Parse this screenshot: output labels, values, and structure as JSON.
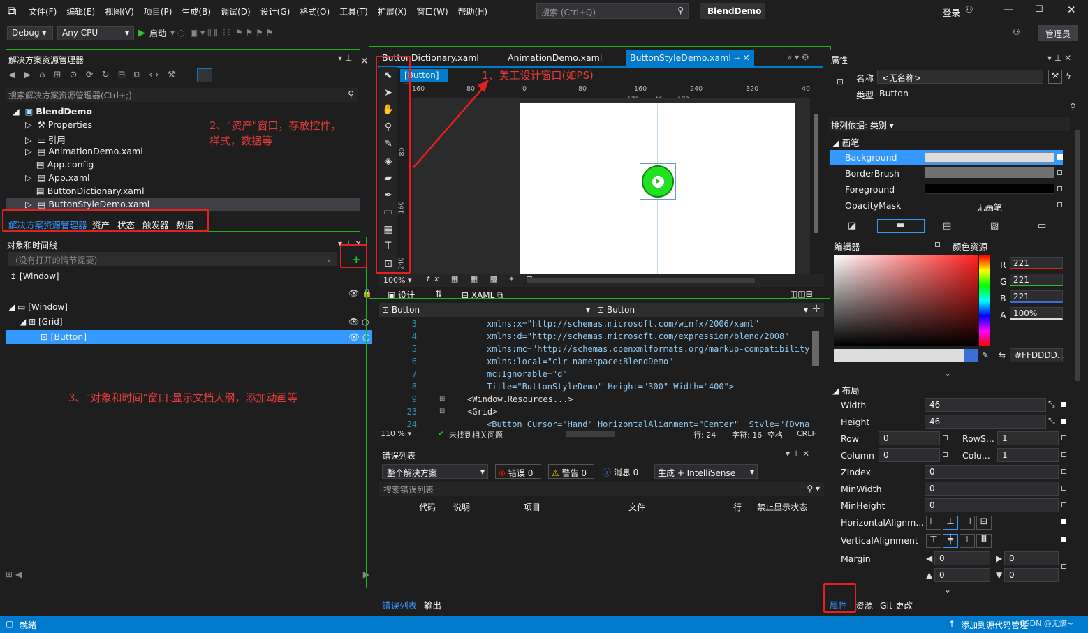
{
  "menu": {
    "items": [
      "文件(F)",
      "编辑(E)",
      "视图(V)",
      "项目(P)",
      "生成(B)",
      "调试(D)",
      "设计(G)",
      "格式(O)",
      "工具(T)",
      "扩展(X)",
      "窗口(W)",
      "帮助(H)"
    ],
    "search_placeholder": "搜索 (Ctrl+Q)",
    "app_name": "BlendDemo",
    "login": "登录",
    "admin": "管理员"
  },
  "toolbar": {
    "config": "Debug",
    "platform": "Any CPU",
    "start": "启动"
  },
  "solution": {
    "title": "解决方案资源管理器",
    "search": "搜索解决方案资源管理器(Ctrl+;)",
    "root": "BlendDemo",
    "items": [
      "Properties",
      "引用",
      "AnimationDemo.xaml",
      "App.config",
      "App.xaml",
      "ButtonDictionary.xaml",
      "ButtonStyleDemo.xaml"
    ],
    "tabs": [
      "解决方案资源管理器",
      "资产",
      "状态",
      "触发器",
      "数据"
    ]
  },
  "objects": {
    "title": "对象和时间线",
    "storyboard": "(没有打开的情节提要)",
    "window_top": "[Window]",
    "window": "[Window]",
    "grid": "[Grid]",
    "button": "[Button]"
  },
  "notes": {
    "n1": "1、美工设计窗口(如PS)",
    "n2a": "2、\"资产\"窗口，存放控件，",
    "n2b": "样式，数据等",
    "n3": "3、\"对象和时间\"窗口:显示文档大纲，添加动画等"
  },
  "editor": {
    "tabs": [
      "ButtonDictionary.xaml",
      "AnimationDemo.xaml",
      "ButtonStyleDemo.xaml"
    ],
    "breadcrumb": "[Button]",
    "ruler_h": [
      "160",
      "80",
      "0",
      "80",
      "160",
      "240",
      "320",
      "40"
    ],
    "ruler_marks": [
      "173",
      "46",
      "173"
    ],
    "ruler_v": [
      "80",
      "160",
      "240"
    ],
    "zoom": "100%",
    "design_tab": "设计",
    "xaml_tab": "XAML",
    "scope_left": "Button",
    "scope_right": "Button",
    "line_numbers": [
      "3",
      "4",
      "5",
      "6",
      "7",
      "8",
      "9",
      "23",
      "24"
    ],
    "code": [
      "xmlns:x=\"http://schemas.microsoft.com/winfx/2006/xaml\"",
      "xmlns:d=\"http://schemas.microsoft.com/expression/blend/2008\"",
      "xmlns:mc=\"http://schemas.openxmlformats.org/markup-compatibility/",
      "xmlns:local=\"clr-namespace:BlendDemo\"",
      "mc:Ignorable=\"d\"",
      "Title=\"ButtonStyleDemo\" Height=\"300\" Width=\"400\">",
      "<Window.Resources...>",
      "<Grid>",
      "<Button Cursor=\"Hand\" HorizontalAlignment=\"Center\"  Style=\"{Dynar"
    ],
    "code_zoom": "110 %",
    "no_issues": "未找到相关问题",
    "row": "行: 24",
    "col": "字符: 16",
    "space": "空格",
    "crlf": "CRLF"
  },
  "errors": {
    "title": "错误列表",
    "scope": "整个解决方案",
    "err": "错误 0",
    "warn": "警告 0",
    "info": "消息 0",
    "build": "生成 + IntelliSense",
    "search": "搜索错误列表",
    "cols": [
      "代码",
      "说明",
      "项目",
      "文件",
      "行",
      "禁止显示状态"
    ],
    "bottom_tabs": [
      "错误列表",
      "输出"
    ]
  },
  "props": {
    "title": "属性",
    "name_label": "名称",
    "name_value": "<无名称>",
    "type_label": "类型",
    "type_value": "Button",
    "sort": "排列依据: 类别",
    "brush_section": "画笔",
    "brushes": [
      "Background",
      "BorderBrush",
      "Foreground",
      "OpacityMask"
    ],
    "opacity_none": "无画笔",
    "editor_label": "编辑器",
    "color_res": "颜色资源",
    "rgba": [
      {
        "k": "R",
        "v": "221"
      },
      {
        "k": "G",
        "v": "221"
      },
      {
        "k": "B",
        "v": "221"
      },
      {
        "k": "A",
        "v": "100%"
      }
    ],
    "hex": "#FFDDDD...",
    "layout_section": "布局",
    "width_label": "Width",
    "width": "46",
    "height_label": "Height",
    "height": "46",
    "row_label": "Row",
    "row": "0",
    "rowspan_label": "RowS...",
    "rowspan": "1",
    "column_label": "Column",
    "column": "0",
    "colspan_label": "Colu...",
    "colspan": "1",
    "zindex_label": "ZIndex",
    "zindex": "0",
    "minwidth_label": "MinWidth",
    "minwidth": "0",
    "minheight_label": "MinHeight",
    "minheight": "0",
    "halign_label": "HorizontalAlignm...",
    "valign_label": "VerticalAlignment",
    "margin_label": "Margin",
    "margins": [
      "0",
      "0",
      "0",
      "0"
    ],
    "bottom_tabs": [
      "属性",
      "资源",
      "Git 更改"
    ]
  },
  "status": {
    "ready": "就绪",
    "source": "添加到源代码管理",
    "watermark": "CSDN @无熵~"
  },
  "colors": {
    "accent": "#007acc",
    "green": "#1fb31f",
    "red": "#e52020",
    "button": "#22e022"
  }
}
